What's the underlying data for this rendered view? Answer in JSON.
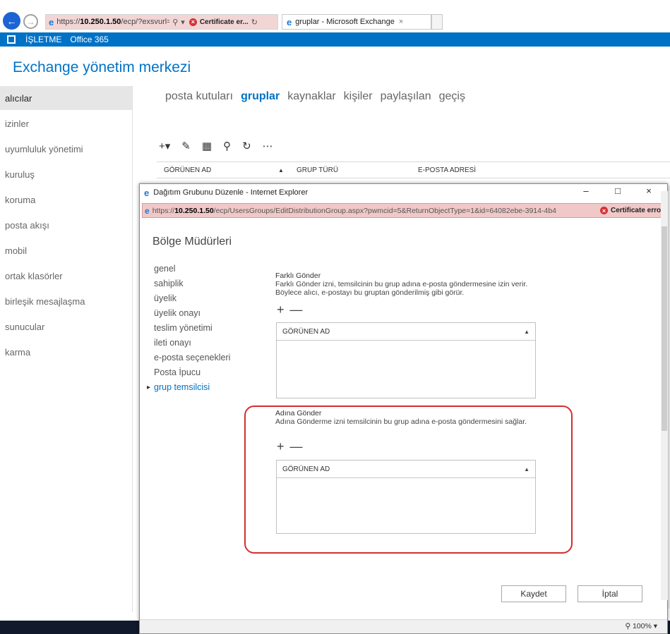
{
  "browser": {
    "address": {
      "url_prefix": "https://",
      "url_host": "10.250.1.50",
      "url_rest": "/ecp/?exsvurl=1",
      "cert_error": "Certificate er..."
    },
    "tab_title": "gruplar - Microsoft Exchange"
  },
  "suite_bar": {
    "org": "İŞLETME",
    "product": "Office 365"
  },
  "eac": {
    "title": "Exchange yönetim merkezi",
    "nav": [
      {
        "label": "alıcılar"
      },
      {
        "label": "izinler"
      },
      {
        "label": "uyumluluk yönetimi"
      },
      {
        "label": "kuruluş"
      },
      {
        "label": "koruma"
      },
      {
        "label": "posta akışı"
      },
      {
        "label": "mobil"
      },
      {
        "label": "ortak klasörler"
      },
      {
        "label": "birleşik mesajlaşma"
      },
      {
        "label": "sunucular"
      },
      {
        "label": "karma"
      }
    ],
    "subnav": [
      {
        "label": "posta kutuları"
      },
      {
        "label": "gruplar"
      },
      {
        "label": "kaynaklar"
      },
      {
        "label": "kişiler"
      },
      {
        "label": "paylaşılan"
      },
      {
        "label": "geçiş"
      }
    ],
    "grid_headers": {
      "display_name": "GÖRÜNEN AD",
      "group_type": "GRUP TÜRÜ",
      "email": "E-POSTA ADRESİ"
    }
  },
  "popup": {
    "window_title": "Dağıtım Grubunu Düzenle - Internet Explorer",
    "address": {
      "url_prefix": "https://",
      "url_host": "10.250.1.50",
      "url_rest": "/ecp/UsersGroups/EditDistributionGroup.aspx?pwmcid=5&ReturnObjectType=1&id=64082ebe-3914-4b4",
      "cert_error": "Certificate error"
    },
    "heading": "Bölge Müdürleri",
    "menu": [
      {
        "label": "genel"
      },
      {
        "label": "sahiplik"
      },
      {
        "label": "üyelik"
      },
      {
        "label": "üyelik onayı"
      },
      {
        "label": "teslim yönetimi"
      },
      {
        "label": "ileti onayı"
      },
      {
        "label": "e-posta seçenekleri"
      },
      {
        "label": "Posta İpucu"
      },
      {
        "label": "grup temsilcisi"
      }
    ],
    "send_as": {
      "title": "Farklı Gönder",
      "description": "Farklı Gönder izni, temsilcinin bu grup adına e-posta göndermesine izin verir. Böylece alıcı, e-postayı bu gruptan gönderilmiş gibi görür.",
      "column": "GÖRÜNEN AD"
    },
    "send_on_behalf": {
      "title": "Adına Gönder",
      "description": "Adına Gönderme izni temsilcinin bu grup adına e-posta göndermesini sağlar.",
      "column": "GÖRÜNEN AD"
    },
    "save_label": "Kaydet",
    "cancel_label": "İptal",
    "zoom": "100%"
  }
}
